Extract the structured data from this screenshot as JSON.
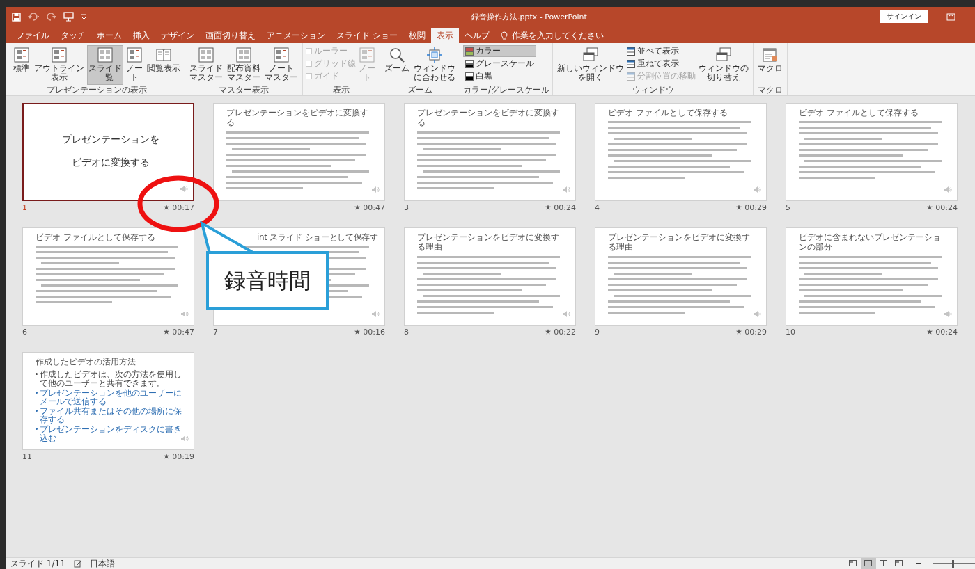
{
  "titlebar": {
    "title": "録音操作方法.pptx  -  PowerPoint",
    "sign_in": "サインイン"
  },
  "tabs": [
    {
      "label": "ファイル",
      "selected": false
    },
    {
      "label": "タッチ",
      "selected": false
    },
    {
      "label": "ホーム",
      "selected": false
    },
    {
      "label": "挿入",
      "selected": false
    },
    {
      "label": "デザイン",
      "selected": false
    },
    {
      "label": "画面切り替え",
      "selected": false
    },
    {
      "label": "アニメーション",
      "selected": false
    },
    {
      "label": "スライド ショー",
      "selected": false
    },
    {
      "label": "校閲",
      "selected": false
    },
    {
      "label": "表示",
      "selected": true
    },
    {
      "label": "ヘルプ",
      "selected": false
    }
  ],
  "tell_me": {
    "placeholder": "作業を入力してください"
  },
  "ribbon": {
    "groups": [
      {
        "label": "プレゼンテーションの表示",
        "items": [
          {
            "kind": "large",
            "lines": [
              "標準"
            ],
            "selected": false,
            "disabled": false
          },
          {
            "kind": "large",
            "lines": [
              "アウトライン",
              "表示"
            ],
            "selected": false,
            "disabled": false
          },
          {
            "kind": "large",
            "lines": [
              "スライド",
              "一覧"
            ],
            "selected": true,
            "disabled": false
          },
          {
            "kind": "large",
            "lines": [
              "ノー",
              "ト"
            ],
            "selected": false,
            "disabled": false
          },
          {
            "kind": "large",
            "lines": [
              "閲覧表示"
            ],
            "selected": false,
            "disabled": false
          }
        ]
      },
      {
        "label": "マスター表示",
        "items": [
          {
            "kind": "large",
            "lines": [
              "スライド",
              "マスター"
            ],
            "selected": false,
            "disabled": false
          },
          {
            "kind": "large",
            "lines": [
              "配布資料",
              "マスター"
            ],
            "selected": false,
            "disabled": false
          },
          {
            "kind": "large",
            "lines": [
              "ノート",
              "マスター"
            ],
            "selected": false,
            "disabled": false
          }
        ]
      },
      {
        "label": "表示",
        "items": [
          {
            "kind": "checks",
            "checks": [
              {
                "label": "ルーラー",
                "checked": false,
                "disabled": true
              },
              {
                "label": "グリッド線",
                "checked": false,
                "disabled": true
              },
              {
                "label": "ガイド",
                "checked": false,
                "disabled": true
              }
            ]
          },
          {
            "kind": "large",
            "lines": [
              "ノー",
              "ト"
            ],
            "selected": false,
            "disabled": true
          }
        ]
      },
      {
        "label": "ズーム",
        "items": [
          {
            "kind": "large",
            "lines": [
              "ズーム"
            ],
            "selected": false,
            "disabled": false
          },
          {
            "kind": "large",
            "lines": [
              "ウィンドウ",
              "に合わせる"
            ],
            "selected": false,
            "disabled": false
          }
        ]
      },
      {
        "label": "カラー/グレースケール",
        "items": [
          {
            "kind": "swatches",
            "swatches": [
              {
                "label": "カラー",
                "selected": true
              },
              {
                "label": "グレースケール",
                "selected": false
              },
              {
                "label": "白黒",
                "selected": false
              }
            ]
          }
        ]
      },
      {
        "label": "ウィンドウ",
        "items": [
          {
            "kind": "large",
            "lines": [
              "新しいウィンドウ",
              "を開く"
            ],
            "selected": false,
            "disabled": false
          },
          {
            "kind": "smalls",
            "smalls": [
              {
                "label": "並べて表示",
                "disabled": false
              },
              {
                "label": "重ねて表示",
                "disabled": false
              },
              {
                "label": "分割位置の移動",
                "disabled": true
              }
            ]
          },
          {
            "kind": "large",
            "lines": [
              "ウィンドウの",
              "切り替え"
            ],
            "selected": false,
            "disabled": false
          }
        ]
      },
      {
        "label": "マクロ",
        "items": [
          {
            "kind": "large",
            "lines": [
              "マクロ"
            ],
            "selected": false,
            "disabled": false
          }
        ]
      }
    ]
  },
  "slides": [
    {
      "number": "1",
      "time": "00:17",
      "selected": true,
      "kind": "title",
      "title_lines": [
        "プレゼンテーションを",
        "ビデオに変換する"
      ]
    },
    {
      "time": "00:47",
      "selected": false,
      "kind": "content",
      "title": "プレゼンテーションをビデオに変換する"
    },
    {
      "number": "3",
      "time": "00:24",
      "selected": false,
      "kind": "content",
      "title": "プレゼンテーションをビデオに変換する"
    },
    {
      "number": "4",
      "time": "00:29",
      "selected": false,
      "kind": "content",
      "title": "ビデオ ファイルとして保存する"
    },
    {
      "number": "5",
      "time": "00:24",
      "selected": false,
      "kind": "content",
      "title": "ビデオ ファイルとして保存する"
    },
    {
      "number": "6",
      "time": "00:47",
      "selected": false,
      "kind": "content",
      "title": "ビデオ ファイルとして保存する"
    },
    {
      "number": "7",
      "time": "00:16",
      "selected": false,
      "kind": "content",
      "title": "int スライド ショーとして保存す",
      "title_hidden_start": true
    },
    {
      "number": "8",
      "time": "00:22",
      "selected": false,
      "kind": "content",
      "title": "プレゼンテーションをビデオに変換する理由"
    },
    {
      "number": "9",
      "time": "00:29",
      "selected": false,
      "kind": "content",
      "title": "プレゼンテーションをビデオに変換する理由"
    },
    {
      "number": "10",
      "time": "00:24",
      "selected": false,
      "kind": "content",
      "title": "ビデオに含まれないプレゼンテーションの部分"
    },
    {
      "number": "11",
      "time": "00:19",
      "selected": false,
      "kind": "content",
      "title": "作成したビデオの活用方法",
      "bullets": [
        {
          "kind": "text",
          "text": "作成したビデオは、次の方法を使用して他のユーザーと共有できます。"
        },
        {
          "kind": "link",
          "text": "プレゼンテーションを他のユーザーにメールで送信する"
        },
        {
          "kind": "link",
          "text": "ファイル共有またはその他の場所に保存する"
        },
        {
          "kind": "link",
          "text": "プレゼンテーションをディスクに書き込む"
        }
      ]
    }
  ],
  "callout": {
    "text": "録音時間"
  },
  "status_bar": {
    "slide": "スライド 1/11",
    "language": "日本語",
    "views": [
      {
        "selected": false
      },
      {
        "selected": true
      },
      {
        "selected": false
      },
      {
        "selected": false
      }
    ],
    "zoom_out": "−",
    "zoom": {
      "level": 0.45
    }
  }
}
